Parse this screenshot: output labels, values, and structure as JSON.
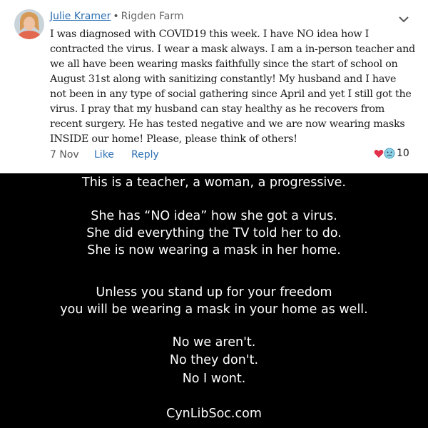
{
  "post": {
    "author": "Julie Kramer",
    "separator": "•",
    "neighborhood": "Rigden Farm",
    "text": "I was diagnosed with COVID19 this week.  I have NO idea how I contracted the virus. I wear a mask always.  I am a in-person teacher and we all have been wearing masks faithfully since the start of school on August 31st along with sanitizing constantly!  My husband and I have not been in any type of social gathering since April and yet I still got the virus.  I pray that my husband can stay healthy as he recovers from recent surgery.  He has tested negative and we are now wearing masks INSIDE our home!  Please, please think of others!",
    "date": "7 Nov",
    "like_label": "Like",
    "reply_label": "Reply",
    "reaction_count": "10",
    "accent_color": "#2b6fb3"
  },
  "meme": {
    "lines": [
      "This is a teacher, a woman, a progressive.",
      "She has “NO idea” how she got a virus.",
      "She did everything the TV told her to do.",
      "She is now wearing a mask in her home.",
      "Unless you stand up for your freedom",
      "you will be wearing a mask in your home as well.",
      "No we aren't.",
      "No they don't.",
      "No I wont.",
      "CynLibSoc.com"
    ]
  }
}
